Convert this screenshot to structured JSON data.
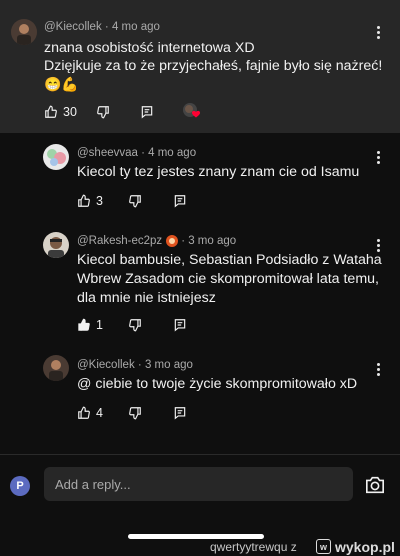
{
  "comments": [
    {
      "author": "@Kiecollek",
      "time": "4 mo ago",
      "lines": [
        "znana osobistość internetowa XD",
        "Dzięjkuje za to że przyjechałeś, fajnie było się nażreć!"
      ],
      "emoji": "😁💪",
      "likes": "30",
      "liked_by_creator": true
    },
    {
      "author": "@sheevvaa",
      "time": "4 mo ago",
      "lines": [
        "Kiecol ty tez jestes znany znam cie od Isamu"
      ],
      "likes": "3"
    },
    {
      "author": "@Rakesh-ec2pz",
      "time": "3 mo ago",
      "lines": [
        "Kiecol bambusie, Sebastian Podsiadło z Wataha",
        "Wbrew Zasadom cie skompromitował lata temu,",
        "dla mnie nie istniejesz"
      ],
      "likes": "1",
      "liked": true
    },
    {
      "author": "@Kiecollek",
      "time": "3 mo ago",
      "lines": [
        "@ ciebie to twoje życie skompromitowało xD"
      ],
      "likes": "4"
    }
  ],
  "reply": {
    "avatar_letter": "P",
    "placeholder": "Add a reply..."
  },
  "watermark": {
    "user": "qwertyytrewqu z",
    "site": "wykop.pl"
  },
  "colors": {
    "background": "#0f0f0f",
    "top_comment_bg": "#272727",
    "meta": "#aaaaaa",
    "heart": "#ff0033"
  }
}
